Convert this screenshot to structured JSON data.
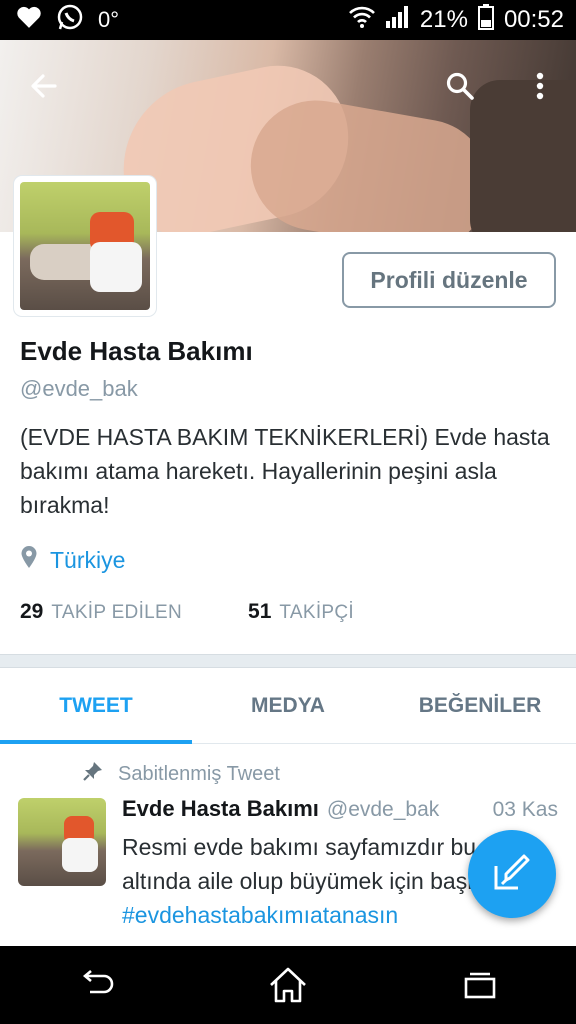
{
  "status_bar": {
    "signal_text": "0°",
    "battery_percent": "21%",
    "time": "00:52"
  },
  "header": {
    "back_icon": "arrow-left-icon",
    "search_icon": "search-icon",
    "more_icon": "more-vert-icon"
  },
  "profile": {
    "edit_button_label": "Profili düzenle",
    "name": "Evde Hasta Bakımı",
    "handle": "@evde_bak",
    "bio": "(EVDE HASTA BAKIM TEKNİKERLERİ)  Evde hasta bakımı atama hareketı. Hayallerinin peşini asla bırakma!",
    "location": "Türkiye",
    "following_count": "29",
    "following_label": "TAKİP EDİLEN",
    "followers_count": "51",
    "followers_label": "TAKİPÇİ"
  },
  "tabs": [
    {
      "label": "TWEET",
      "active": true
    },
    {
      "label": "MEDYA",
      "active": false
    },
    {
      "label": "BEĞENİLER",
      "active": false
    }
  ],
  "pinned_tweet": {
    "pinned_label": "Sabitlenmiş Tweet",
    "author_name": "Evde Hasta Bakımı",
    "author_handle": "@evde_bak",
    "date": "03 Kas",
    "text": "Resmi evde bakımı sayfamızdır bu çatı altında aile olup büyümek için başlıyoruz.",
    "hashtag": "#evdehastabakımıatanasın"
  },
  "colors": {
    "accent": "#1da1f2",
    "link": "#1b95e0",
    "muted": "#8899a6"
  }
}
